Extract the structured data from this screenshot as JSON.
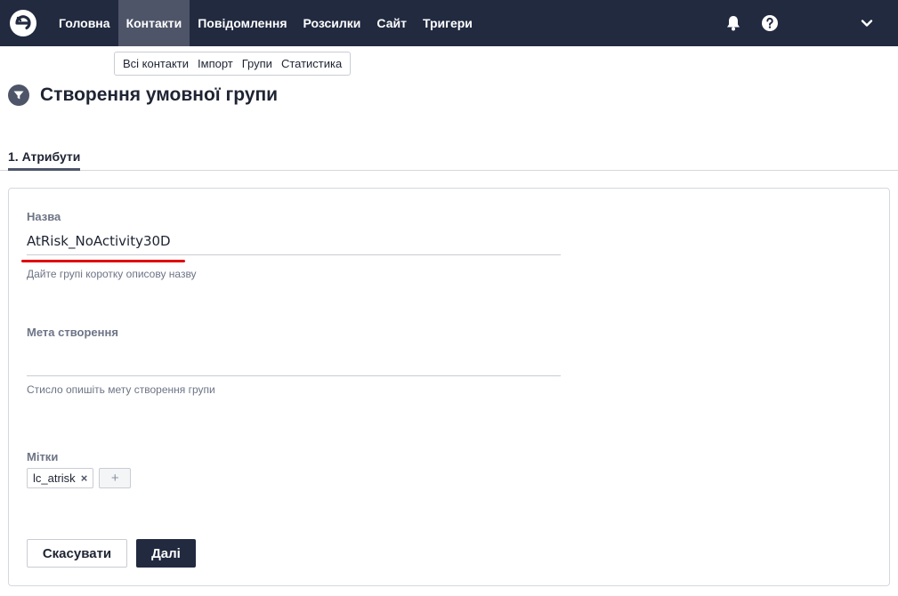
{
  "nav": {
    "items": [
      {
        "label": "Головна"
      },
      {
        "label": "Контакти"
      },
      {
        "label": "Повідомлення"
      },
      {
        "label": "Розсилки"
      },
      {
        "label": "Сайт"
      },
      {
        "label": "Тригери"
      }
    ],
    "active_index": 1,
    "icons": [
      "logo-icon",
      "bell-icon",
      "help-icon",
      "chevron-down-icon"
    ]
  },
  "submenu": {
    "items": [
      {
        "label": "Всі контакти"
      },
      {
        "label": "Імпорт"
      },
      {
        "label": "Групи"
      },
      {
        "label": "Статистика"
      }
    ]
  },
  "page": {
    "title": "Створення умовної групи",
    "icon": "filter-icon"
  },
  "steps": {
    "tab_label": "1. Атрибути"
  },
  "form": {
    "name": {
      "label": "Назва",
      "value": "AtRisk_NoActivity30D",
      "hint": "Дайте групі коротку описову назву"
    },
    "goal": {
      "label": "Мета створення",
      "value": "",
      "hint": "Стисло опишіть мету створення групи"
    },
    "tags": {
      "label": "Мітки",
      "items": [
        {
          "label": "lc_atrisk"
        }
      ],
      "remove_glyph": "×",
      "add_glyph": "+"
    }
  },
  "buttons": {
    "cancel": "Скасувати",
    "next": "Далі"
  },
  "colors": {
    "topbar": "#222a40",
    "active_nav": "#4e5569",
    "accent_red": "#e00000"
  }
}
